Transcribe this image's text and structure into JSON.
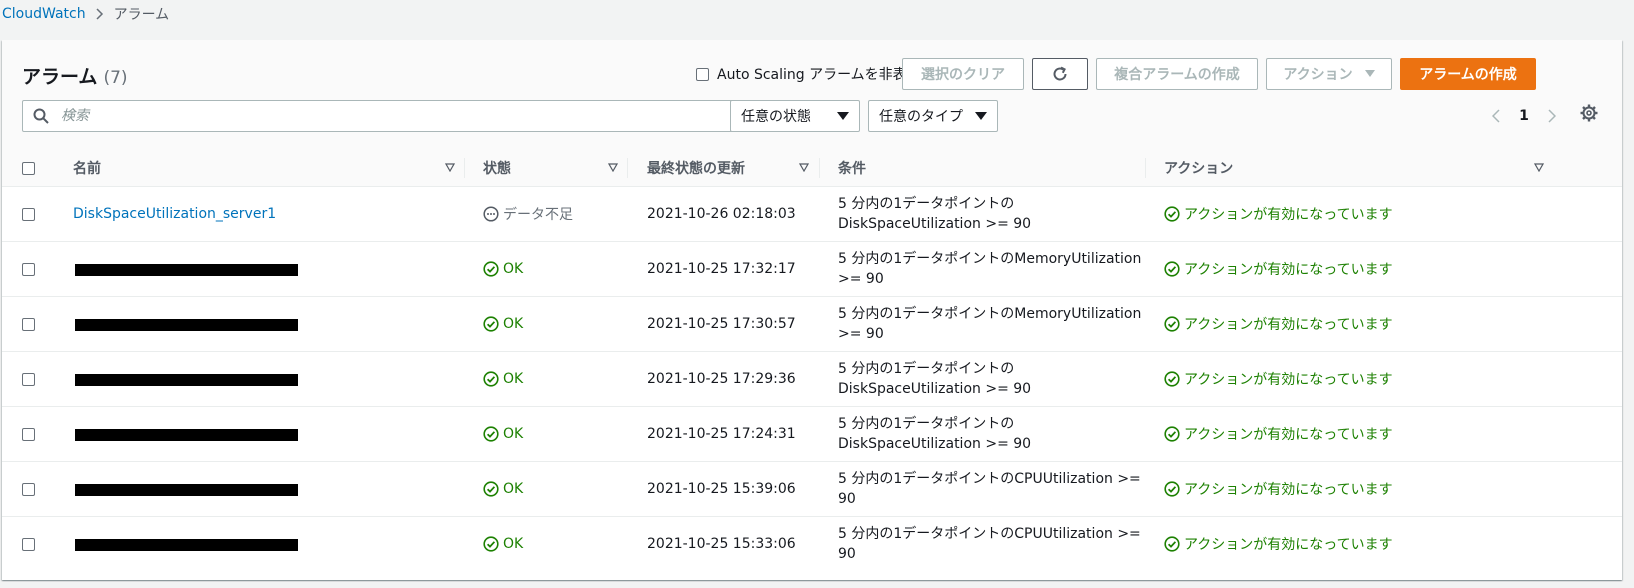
{
  "breadcrumb": {
    "root": "CloudWatch",
    "current": "アラーム"
  },
  "header": {
    "title": "アラーム",
    "count": "(7)",
    "hide_autoscaling_label": "Auto Scaling アラームを非表示",
    "clear_selection": "選択のクリア",
    "create_composite": "複合アラームの作成",
    "actions": "アクション",
    "create_alarm": "アラームの作成"
  },
  "filters": {
    "search_placeholder": "検索",
    "state_filter": "任意の状態",
    "type_filter": "任意のタイプ"
  },
  "pagination": {
    "page": "1"
  },
  "columns": {
    "name": "名前",
    "state": "状態",
    "last_updated": "最終状態の更新",
    "conditions": "条件",
    "actions": "アクション"
  },
  "rows": [
    {
      "name": "DiskSpaceUtilization_server1",
      "state": "データ不足",
      "state_type": "insufficient",
      "updated": "2021-10-26 02:18:03",
      "cond1": "5 分内の1データポイントの",
      "cond2": "DiskSpaceUtilization >= 90",
      "action": "アクションが有効になっています"
    },
    {
      "name": "",
      "state": "OK",
      "state_type": "ok",
      "updated": "2021-10-25 17:32:17",
      "cond1": "5 分内の1データポイントのMemoryUtilization",
      "cond2": ">= 90",
      "action": "アクションが有効になっています"
    },
    {
      "name": "",
      "state": "OK",
      "state_type": "ok",
      "updated": "2021-10-25 17:30:57",
      "cond1": "5 分内の1データポイントのMemoryUtilization",
      "cond2": ">= 90",
      "action": "アクションが有効になっています"
    },
    {
      "name": "",
      "state": "OK",
      "state_type": "ok",
      "updated": "2021-10-25 17:29:36",
      "cond1": "5 分内の1データポイントの",
      "cond2": "DiskSpaceUtilization >= 90",
      "action": "アクションが有効になっています"
    },
    {
      "name": "",
      "state": "OK",
      "state_type": "ok",
      "updated": "2021-10-25 17:24:31",
      "cond1": "5 分内の1データポイントの",
      "cond2": "DiskSpaceUtilization >= 90",
      "action": "アクションが有効になっています"
    },
    {
      "name": "",
      "state": "OK",
      "state_type": "ok",
      "updated": "2021-10-25 15:39:06",
      "cond1": "5 分内の1データポイントのCPUUtilization >=",
      "cond2": "90",
      "action": "アクションが有効になっています"
    },
    {
      "name": "",
      "state": "OK",
      "state_type": "ok",
      "updated": "2021-10-25 15:33:06",
      "cond1": "5 分内の1データポイントのCPUUtilization >=",
      "cond2": "90",
      "action": "アクションが有効になっています"
    }
  ],
  "colors": {
    "link": "#0073bb",
    "ok": "#1d8102",
    "primary": "#ec7211"
  }
}
